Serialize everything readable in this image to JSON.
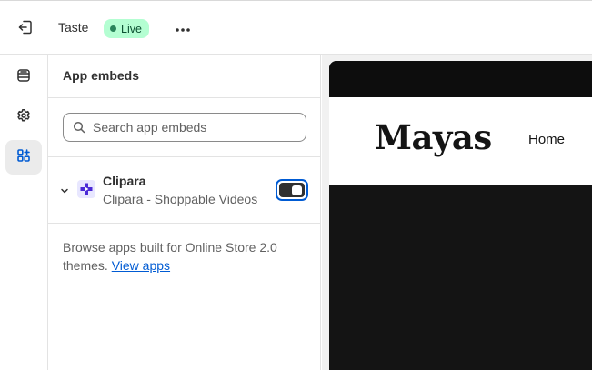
{
  "topbar": {
    "theme_name": "Taste",
    "status_badge": "Live",
    "icons": {
      "exit": "exit-icon",
      "more": "more-horizontal-icon"
    }
  },
  "rail": {
    "items": [
      {
        "name": "sections",
        "icon": "sections-icon",
        "active": false
      },
      {
        "name": "settings",
        "icon": "gear-icon",
        "active": false
      },
      {
        "name": "app-embeds",
        "icon": "apps-add-icon",
        "active": true
      }
    ]
  },
  "panel": {
    "title": "App embeds",
    "search": {
      "placeholder": "Search app embeds",
      "value": ""
    },
    "apps": [
      {
        "name": "Clipara",
        "description": "Clipara - Shoppable Videos",
        "enabled": true
      }
    ],
    "browse": {
      "text": "Browse apps built for Online Store 2.0 themes.",
      "link_label": "View apps"
    }
  },
  "preview": {
    "logo_text": "Mayas",
    "nav_home": "Home"
  },
  "colors": {
    "accent": "#005bd3",
    "badge_bg": "#b4fed2",
    "badge_text": "#0c5132",
    "toggle_on": "#303030",
    "canvas_dark": "#141414"
  }
}
